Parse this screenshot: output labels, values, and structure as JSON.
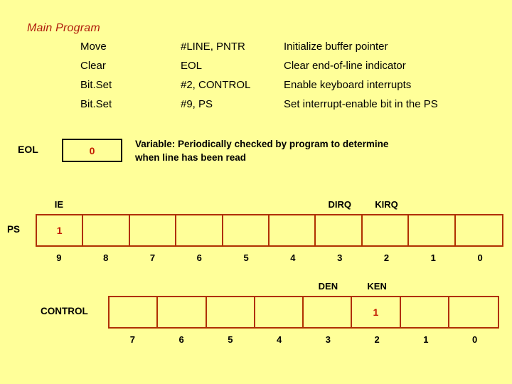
{
  "slide": {
    "background_color": "#ffff99",
    "title": "Main Program",
    "title_color": "#b01c0c"
  },
  "program": {
    "rows": [
      {
        "mnemonic": "Move",
        "operand": "#LINE, PNTR",
        "comment": "Initialize buffer pointer"
      },
      {
        "mnemonic": "Clear",
        "operand": "EOL",
        "comment": "Clear end-of-line indicator"
      },
      {
        "mnemonic": "Bit.Set",
        "operand": "#2, CONTROL",
        "comment": "Enable keyboard interrupts"
      },
      {
        "mnemonic": "Bit.Set",
        "operand": "#9, PS",
        "comment": "Set interrupt-enable bit in the PS"
      }
    ]
  },
  "eol": {
    "label": "EOL",
    "value": "0",
    "value_color": "#c21a00",
    "border_color": "#000000",
    "note_line1": "Variable:  Periodically checked by program to determine",
    "note_line2": "when line has been read"
  },
  "ps_register": {
    "name": "PS",
    "border_color": "#b03000",
    "bit_labels": [
      "9",
      "8",
      "7",
      "6",
      "5",
      "4",
      "3",
      "2",
      "1",
      "0"
    ],
    "cell_values": [
      "1",
      "",
      "",
      "",
      "",
      "",
      "",
      "",
      "",
      ""
    ],
    "flags": [
      {
        "name": "IE",
        "bit_index": 0
      },
      {
        "name": "DIRQ",
        "bit_index": 6
      },
      {
        "name": "KIRQ",
        "bit_index": 7
      }
    ]
  },
  "control_register": {
    "name": "CONTROL",
    "border_color": "#b03000",
    "bit_labels": [
      "7",
      "6",
      "5",
      "4",
      "3",
      "2",
      "1",
      "0"
    ],
    "cell_values": [
      "",
      "",
      "",
      "",
      "",
      "1",
      "",
      ""
    ],
    "flags": [
      {
        "name": "DEN",
        "bit_index": 4
      },
      {
        "name": "KEN",
        "bit_index": 5
      }
    ]
  }
}
